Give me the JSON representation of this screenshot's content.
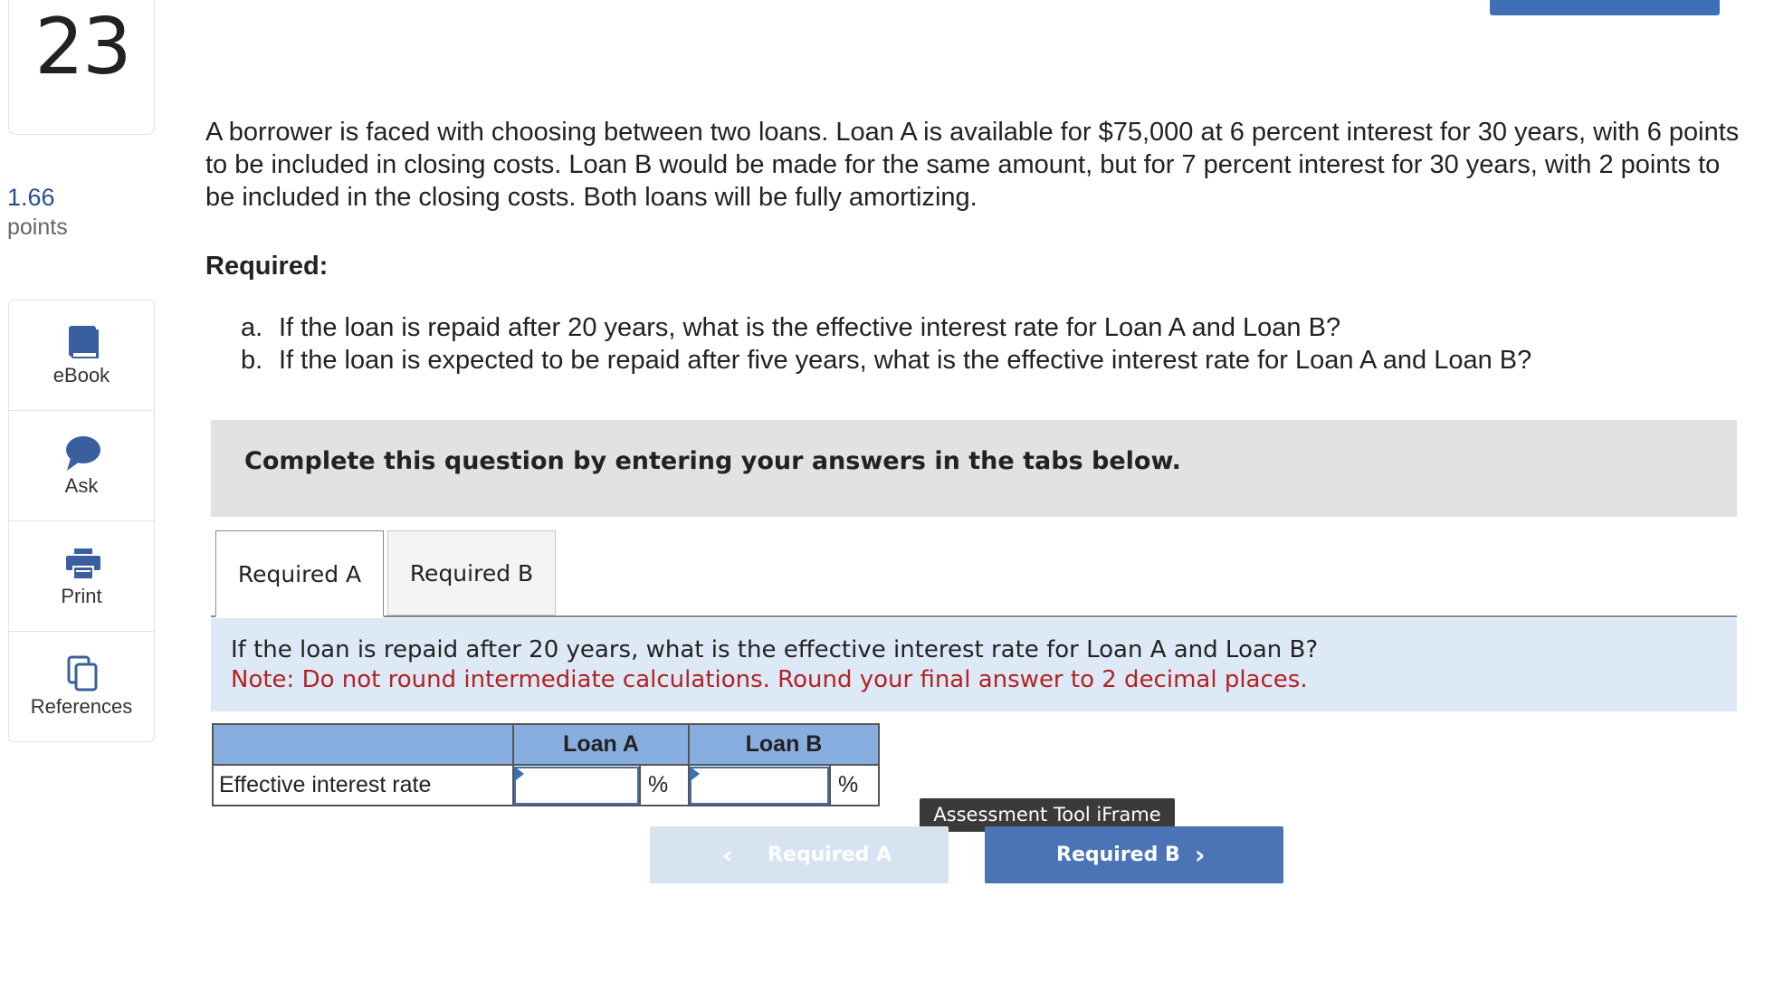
{
  "question": {
    "number": "23",
    "points_value": "1.66",
    "points_label": "points"
  },
  "tools": [
    {
      "label": "eBook",
      "icon": "book-icon"
    },
    {
      "label": "Ask",
      "icon": "speech-bubble-icon"
    },
    {
      "label": "Print",
      "icon": "printer-icon"
    },
    {
      "label": "References",
      "icon": "copy-pages-icon"
    }
  ],
  "problem": {
    "intro": "A borrower is faced with choosing between two loans. Loan A is available for $75,000 at 6 percent interest for 30 years, with 6 points to be included in closing costs. Loan B would be made for the same amount, but for 7 percent interest for 30 years, with 2 points to be included in the closing costs. Both loans will be fully amortizing.",
    "required_heading": "Required:",
    "items": [
      {
        "letter": "a.",
        "text": "If the loan is repaid after 20 years, what is the effective interest rate for Loan A and Loan B?"
      },
      {
        "letter": "b.",
        "text": "If the loan is expected to be repaid after five years, what is the effective interest rate for Loan A and Loan B?"
      }
    ]
  },
  "complete_bar": "Complete this question by entering your answers in the tabs below.",
  "tabs": [
    {
      "label": "Required A",
      "active": true
    },
    {
      "label": "Required B",
      "active": false
    }
  ],
  "panel": {
    "question": "If the loan is repaid after 20 years, what is the effective interest rate for Loan A and Loan B?",
    "note": "Note: Do not round intermediate calculations. Round your final answer to 2 decimal places."
  },
  "answer_table": {
    "headers": [
      "",
      "Loan A",
      "Loan B"
    ],
    "row_label": "Effective interest rate",
    "loan_a_value": "",
    "loan_b_value": "",
    "unit": "%"
  },
  "tooltip": "Assessment Tool iFrame",
  "nav": {
    "prev_label": "Required A",
    "next_label": "Required B"
  },
  "colors": {
    "accent": "#4a74b5",
    "table_header": "#88aee0",
    "panel_bg": "#dde9f7",
    "note_red": "#b22222",
    "points_blue": "#2a4d8f"
  }
}
